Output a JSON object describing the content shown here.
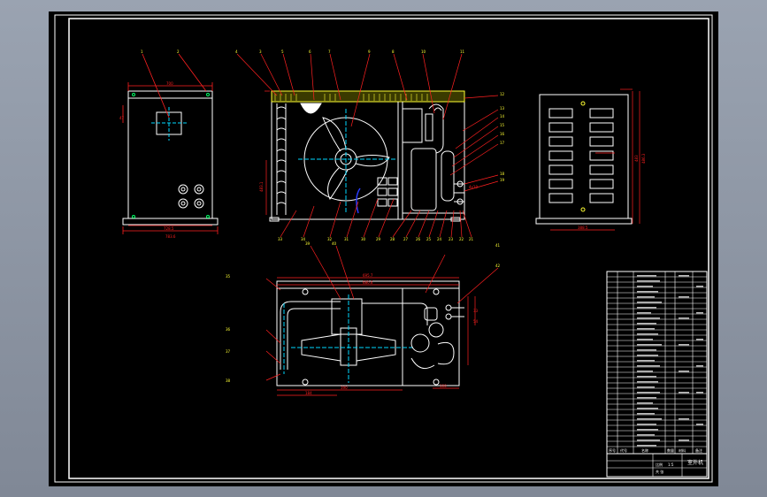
{
  "view": {
    "background": "#000000",
    "desktop_gradient": [
      "#9aa3b1",
      "#808896"
    ],
    "colors": {
      "frame": "#ffffff",
      "geometry": "#ffffff",
      "dimension": "#ff2020",
      "leader": "#ff2020",
      "balloon_text": "#ffff33",
      "centerline": "#00d8ff",
      "hidden": "#2a3cff",
      "hatch": "#ffff33",
      "accent_green": "#00ff66"
    }
  },
  "balloons_front": [
    "1",
    "2",
    "3",
    "4",
    "5",
    "6",
    "7",
    "8",
    "9",
    "10",
    "11",
    "12",
    "13",
    "14",
    "15",
    "16",
    "17",
    "18",
    "19",
    "20",
    "21",
    "22",
    "23",
    "24",
    "25",
    "26",
    "27",
    "28",
    "29",
    "30",
    "31",
    "32",
    "33",
    "34"
  ],
  "balloons_top": [
    "35",
    "36",
    "37",
    "38",
    "39",
    "40",
    "41",
    "42"
  ],
  "title_block": {
    "drawing_title": "室外机",
    "scale_label": "比例",
    "scale_value": "1:5",
    "sheet_label": "共 张",
    "heading_row": [
      "序号",
      "代号",
      "名称",
      "数量",
      "材料",
      "备注"
    ]
  }
}
